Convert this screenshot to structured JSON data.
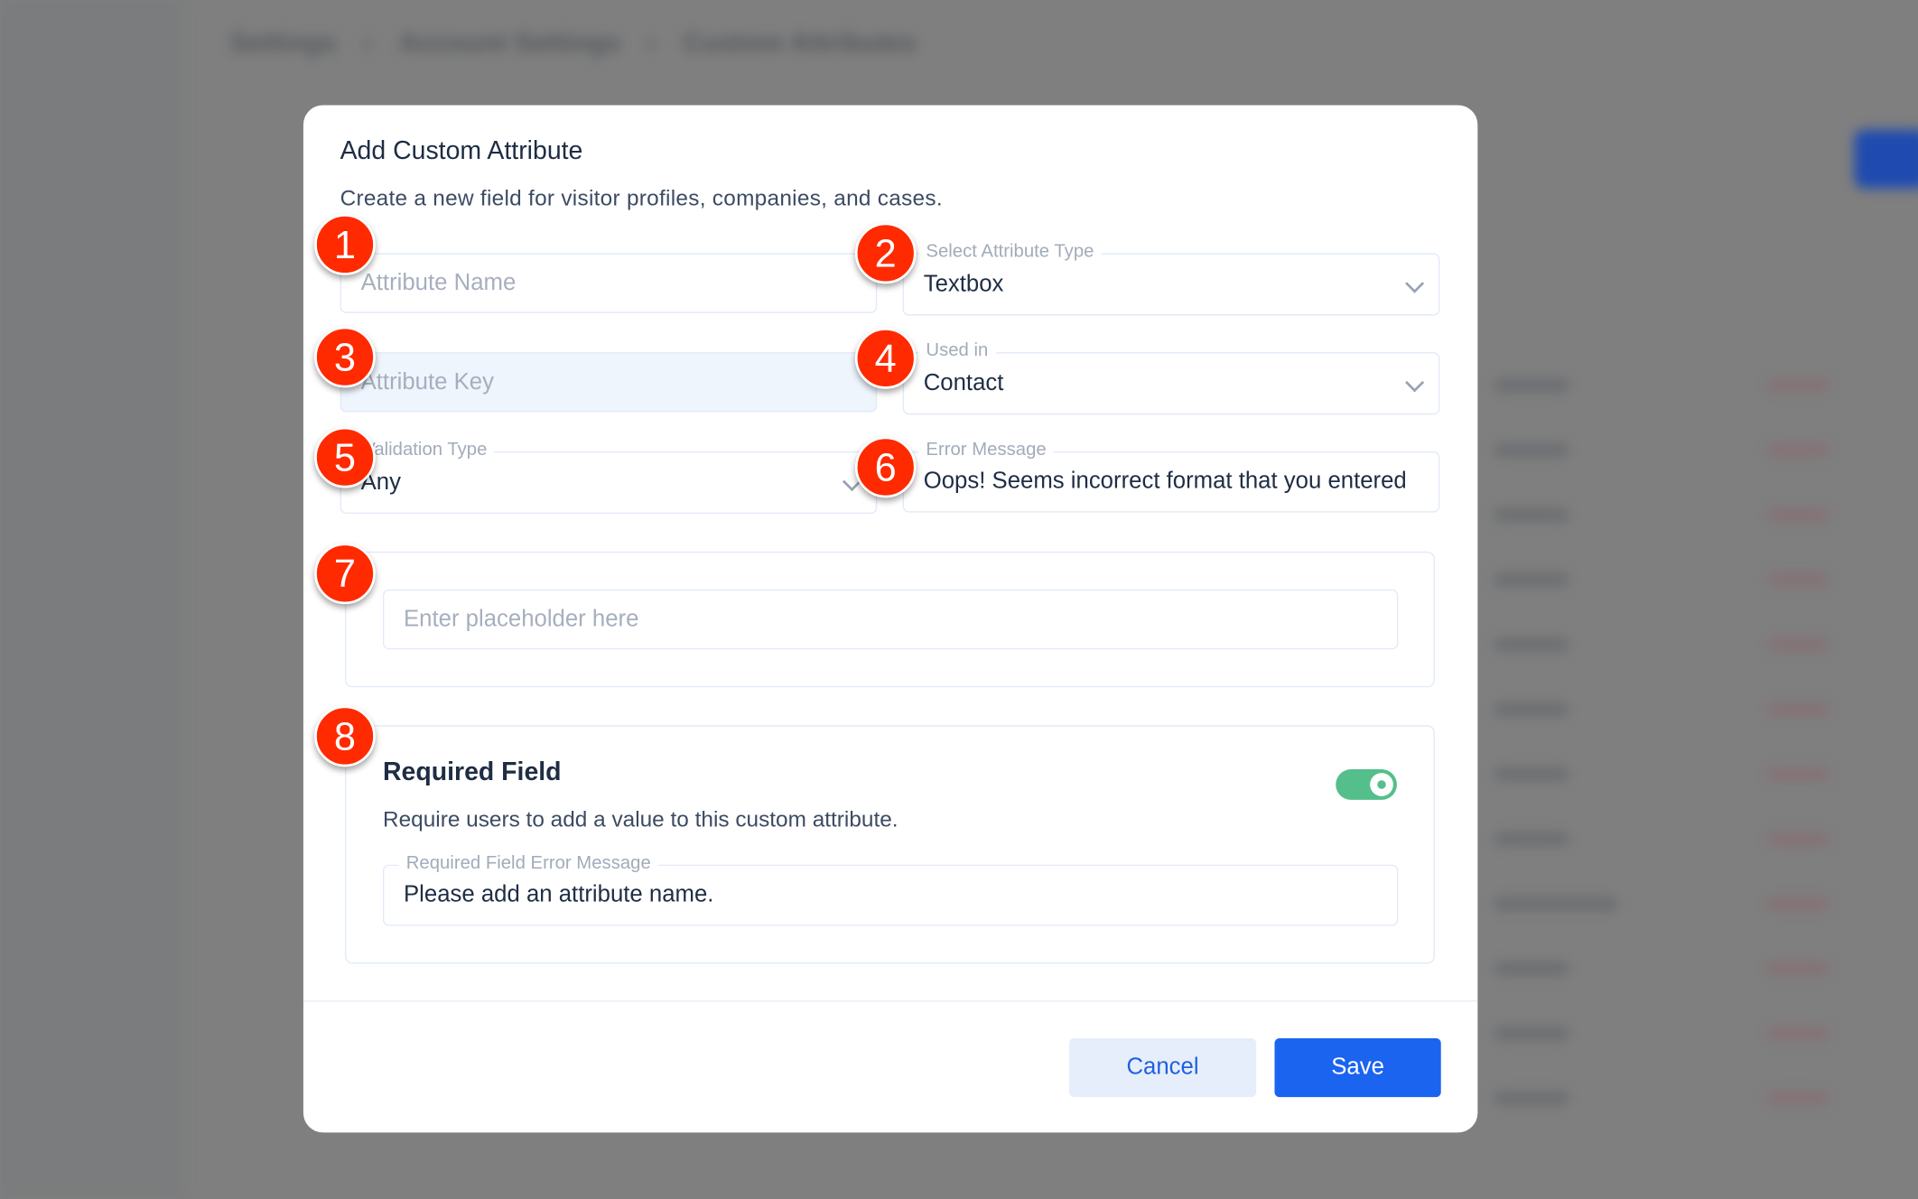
{
  "background": {
    "breadcrumb": [
      "Settings",
      "Account Settings",
      "Custom Attributes"
    ]
  },
  "modal": {
    "title": "Add Custom Attribute",
    "subtitle": "Create a new field for visitor profiles, companies, and cases.",
    "fields": {
      "attribute_name": {
        "placeholder": "Attribute Name"
      },
      "attribute_type": {
        "label": "Select Attribute Type",
        "value": "Textbox"
      },
      "attribute_key": {
        "placeholder": "Attribute Key",
        "disabled": true
      },
      "used_in": {
        "label": "Used in",
        "value": "Contact"
      },
      "validation_type": {
        "label": "Validation Type",
        "value": "Any"
      },
      "error_message": {
        "label": "Error Message",
        "value": "Oops! Seems incorrect format that you entered"
      },
      "placeholder": {
        "placeholder": "Enter placeholder here"
      }
    },
    "required": {
      "title": "Required Field",
      "description": "Require users to add a value to this custom attribute.",
      "enabled": true,
      "error_label": "Required Field Error Message",
      "error_value": "Please add an attribute name."
    },
    "buttons": {
      "cancel": "Cancel",
      "save": "Save"
    }
  },
  "annotations": [
    "1",
    "2",
    "3",
    "4",
    "5",
    "6",
    "7",
    "8"
  ],
  "colors": {
    "primary": "#1a64f0",
    "toggle_on": "#55bf8c",
    "annotation": "#ff2a00"
  }
}
